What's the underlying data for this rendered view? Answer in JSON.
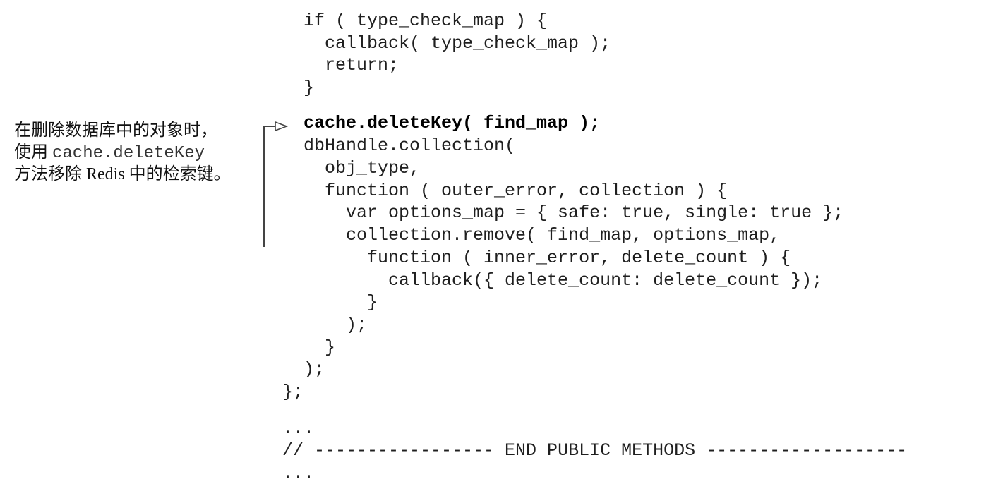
{
  "annotation": {
    "line1": "在删除数据库中的对象时，",
    "line2_prefix": "使用 ",
    "line2_code": "cache.deleteKey",
    "line3": "方法移除 Redis 中的检索键。"
  },
  "code": {
    "line_01": "if ( type_check_map ) {",
    "line_02": "  callback( type_check_map );",
    "line_03": "  return;",
    "line_04": "}",
    "line_05": "cache.deleteKey( find_map );",
    "line_06": "dbHandle.collection(",
    "line_07": "  obj_type,",
    "line_08": "  function ( outer_error, collection ) {",
    "line_09": "    var options_map = { safe: true, single: true };",
    "line_10": "    collection.remove( find_map, options_map,",
    "line_11": "      function ( inner_error, delete_count ) {",
    "line_12": "        callback({ delete_count: delete_count });",
    "line_13": "      }",
    "line_14": "    );",
    "line_15": "  }",
    "line_16": ");",
    "line_17": "};",
    "line_18": "...",
    "line_19": "// ----------------- END PUBLIC METHODS -------------------",
    "line_20": "..."
  }
}
